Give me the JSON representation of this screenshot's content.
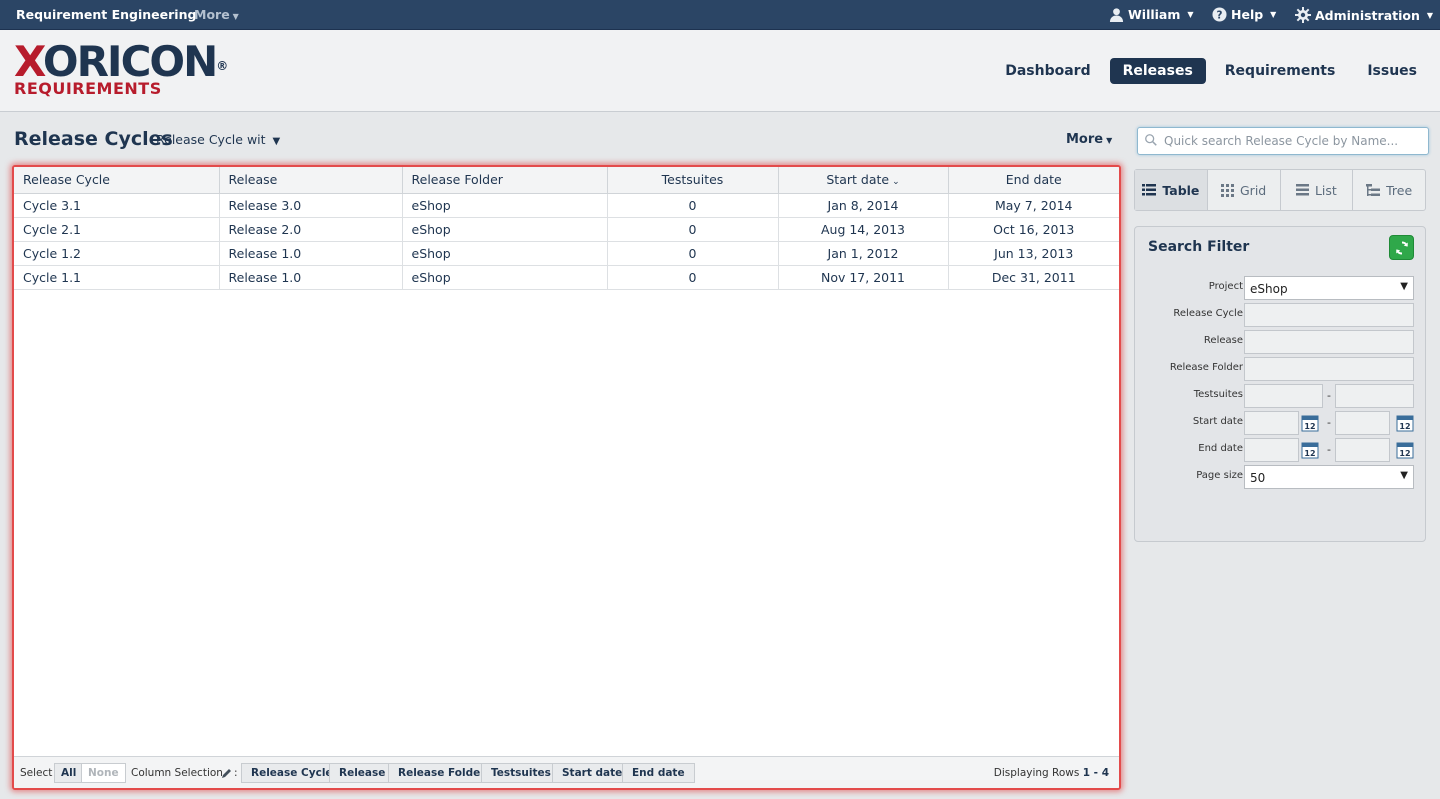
{
  "topbar": {
    "app_title": "Requirement Engineering",
    "more": "More",
    "user": "William",
    "help": "Help",
    "admin": "Administration"
  },
  "logo": {
    "x": "X",
    "rest": "ORICON",
    "reg": "®",
    "sub": "REQUIREMENTS"
  },
  "nav": {
    "tabs": [
      {
        "label": "Dashboard",
        "active": false
      },
      {
        "label": "Releases",
        "active": true
      },
      {
        "label": "Requirements",
        "active": false
      },
      {
        "label": "Issues",
        "active": false
      }
    ]
  },
  "page": {
    "title": "Release Cycles",
    "view_select": "Release Cycle wit",
    "more": "More",
    "search_placeholder": "Quick search Release Cycle by Name..."
  },
  "table": {
    "columns": [
      "Release Cycle",
      "Release",
      "Release Folder",
      "Testsuites",
      "Start date",
      "End date"
    ],
    "rows": [
      [
        "Cycle 3.1",
        "Release 3.0",
        "eShop",
        "0",
        "Jan 8, 2014",
        "May 7, 2014"
      ],
      [
        "Cycle 2.1",
        "Release 2.0",
        "eShop",
        "0",
        "Aug 14, 2013",
        "Oct 16, 2013"
      ],
      [
        "Cycle 1.2",
        "Release 1.0",
        "eShop",
        "0",
        "Jan 1, 2012",
        "Jun 13, 2013"
      ],
      [
        "Cycle 1.1",
        "Release 1.0",
        "eShop",
        "0",
        "Nov 17, 2011",
        "Dec 31, 2011"
      ]
    ]
  },
  "footer": {
    "select_label": "Select",
    "all": "All",
    "none": "None",
    "column_selection": "Column Selection",
    "colon": ":",
    "column_buttons": [
      "Release Cycle",
      "Release",
      "Release Folder",
      "Testsuites",
      "Start date",
      "End date"
    ],
    "displaying": "Displaying Rows",
    "range": "1 - 4"
  },
  "views": {
    "table": "Table",
    "grid": "Grid",
    "list": "List",
    "tree": "Tree"
  },
  "filter": {
    "title": "Search Filter",
    "project_label": "Project",
    "project_value": "eShop",
    "release_cycle_label": "Release Cycle",
    "release_label": "Release",
    "release_folder_label": "Release Folder",
    "testsuites_label": "Testsuites",
    "start_date_label": "Start date",
    "end_date_label": "End date",
    "page_size_label": "Page size",
    "page_size_value": "50",
    "range_sep": "-",
    "cal_day": "12"
  },
  "colors": {
    "navy": "#1f3550",
    "brand_red": "#b71c2c",
    "refresh_green": "#2fa84a",
    "highlight_red": "#e34b4b"
  }
}
